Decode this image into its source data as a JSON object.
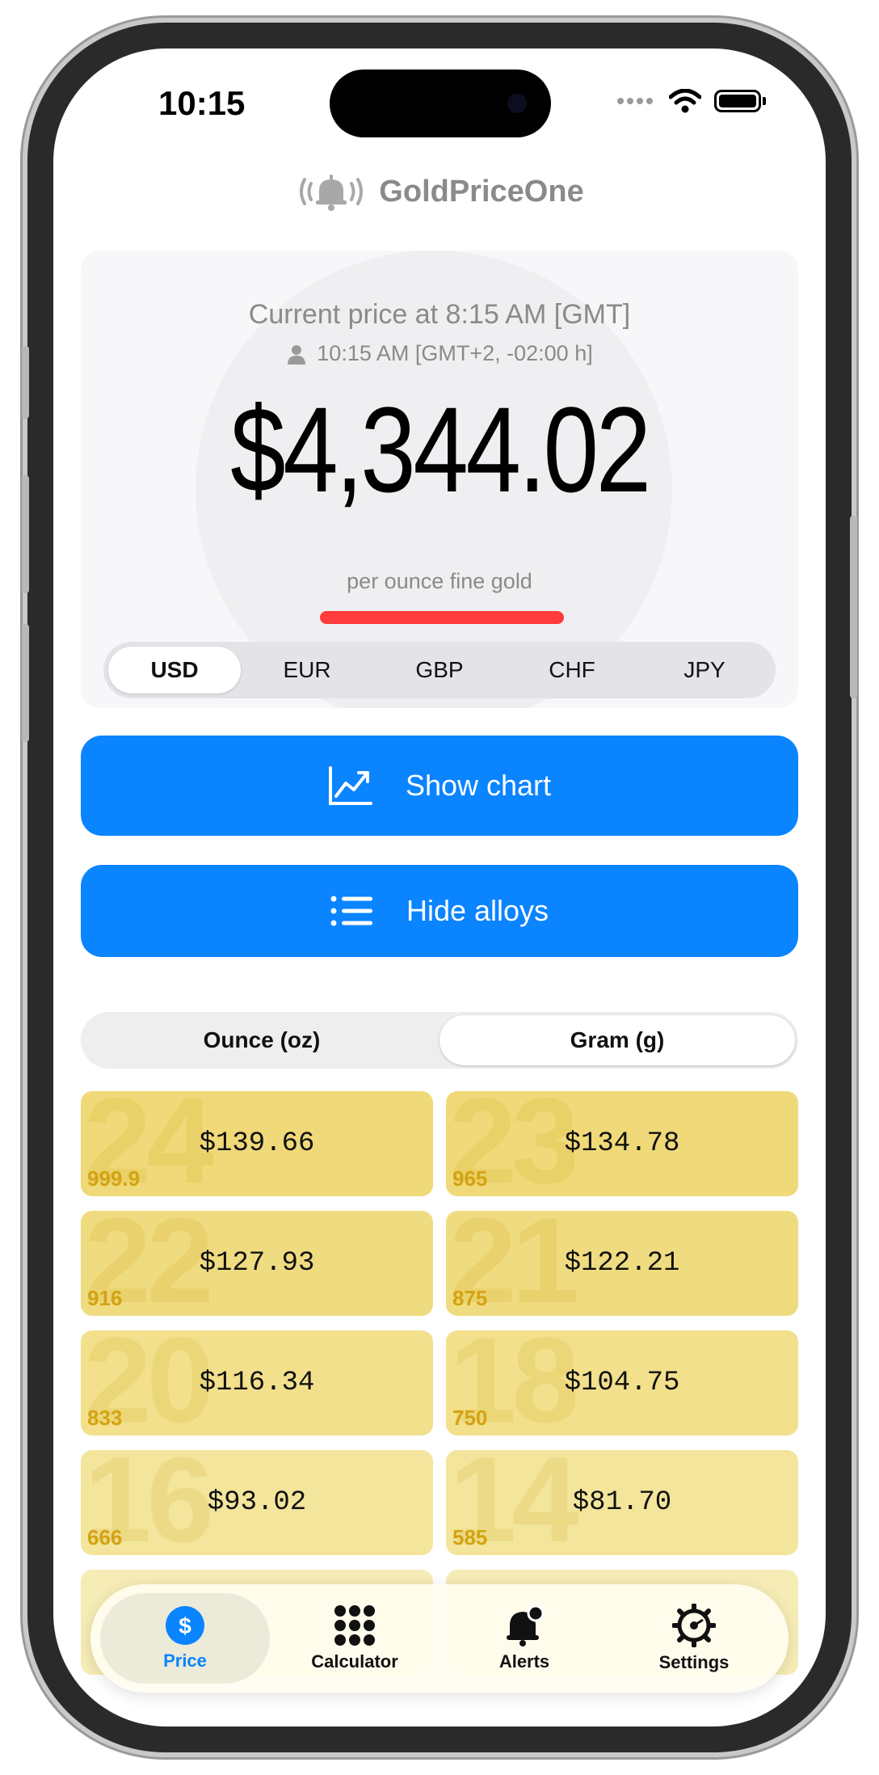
{
  "status_bar": {
    "time": "10:15"
  },
  "header": {
    "app_name": "GoldPriceOne",
    "icon": "ringing-bell-icon"
  },
  "price_card": {
    "label": "Current price at 8:15 AM [GMT]",
    "local_time": "10:15 AM [GMT+2, -02:00 h]",
    "price": "$4,344.02",
    "unit": "per ounce fine gold",
    "trend_color": "#ff3b3b",
    "currencies": [
      "USD",
      "EUR",
      "GBP",
      "CHF",
      "JPY"
    ],
    "selected_currency": "USD"
  },
  "buttons": {
    "show_chart": "Show chart",
    "hide_alloys": "Hide alloys"
  },
  "unit_toggle": {
    "options": [
      "Ounce (oz)",
      "Gram (g)"
    ],
    "selected": "Gram (g)"
  },
  "alloys": [
    {
      "karat": "24",
      "fineness": "999.9",
      "price": "$139.66"
    },
    {
      "karat": "23",
      "fineness": "965",
      "price": "$134.78"
    },
    {
      "karat": "22",
      "fineness": "916",
      "price": "$127.93"
    },
    {
      "karat": "21",
      "fineness": "875",
      "price": "$122.21"
    },
    {
      "karat": "20",
      "fineness": "833",
      "price": "$116.34"
    },
    {
      "karat": "18",
      "fineness": "750",
      "price": "$104.75"
    },
    {
      "karat": "16",
      "fineness": "666",
      "price": "$93.02"
    },
    {
      "karat": "14",
      "fineness": "585",
      "price": "$81.70"
    },
    {
      "karat": "",
      "fineness": "",
      "price": ""
    },
    {
      "karat": "",
      "fineness": "",
      "price": ""
    }
  ],
  "tabbar": {
    "items": [
      {
        "label": "Price",
        "icon": "dollar-icon",
        "active": true
      },
      {
        "label": "Calculator",
        "icon": "keypad-icon",
        "active": false
      },
      {
        "label": "Alerts",
        "icon": "bell-icon",
        "active": false
      },
      {
        "label": "Settings",
        "icon": "gear-icon",
        "active": false
      }
    ]
  },
  "colors": {
    "accent": "#0a84ff",
    "alloy_bg": [
      "#f0d978",
      "#f0dc80",
      "#f2e08c",
      "#f3e59c",
      "#f6ecb6"
    ]
  }
}
